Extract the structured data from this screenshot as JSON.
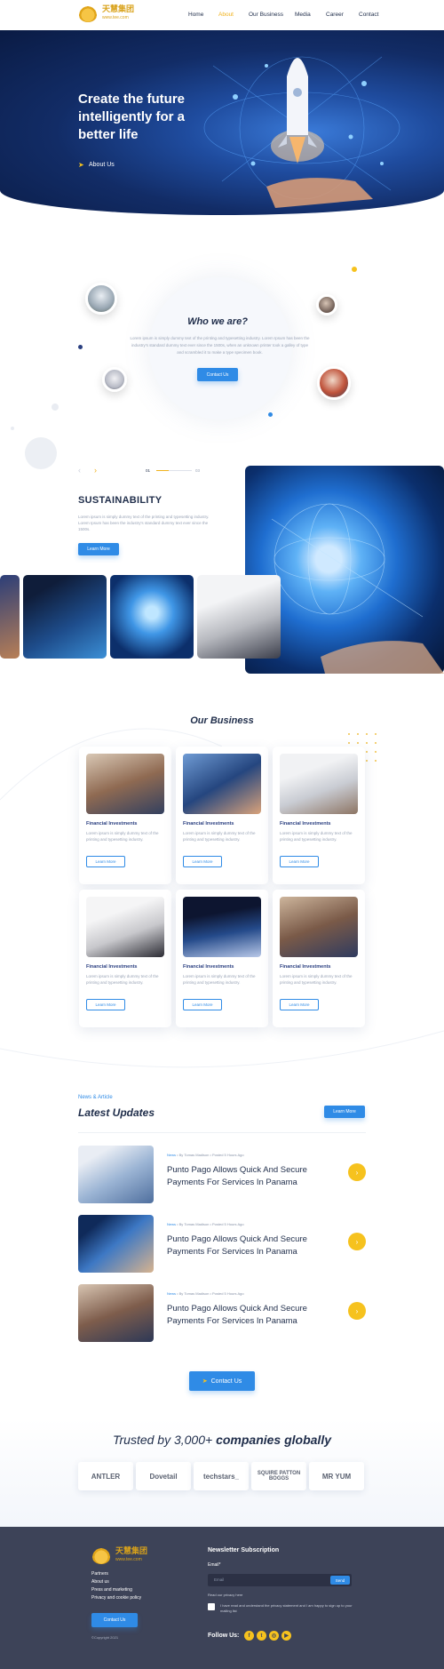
{
  "brand": {
    "name_cn": "天慧集团",
    "url": "www.tee.com"
  },
  "nav": {
    "items": [
      "Home",
      "About",
      "Our Business",
      "Media",
      "Career",
      "Contact"
    ],
    "active": "About"
  },
  "hero": {
    "title": "Create the future intelligently for a better life",
    "cta": "About Us"
  },
  "who": {
    "title": "Who we are?",
    "text": "Lorem ipsum is simply dummy text of the printing and typesetting industry. Lorem Ipsum has been the industry's standard dummy text ever since the 1500s, when an unknown printer took a galley of type and scrambled it to make a type specimen book.",
    "cta": "Contact Us"
  },
  "sustainability": {
    "slide_current": "01",
    "slide_total": "03",
    "title": "SUSTAINABILITY",
    "text": "Lorem ipsum is simply dummy text of the printing and typesetting industry. Lorem Ipsum has been the industry's standard dummy text ever since the 1500s.",
    "cta": "Learn More"
  },
  "business": {
    "title": "Our Business",
    "cards": [
      {
        "title": "Financial Investments",
        "desc": "Lorem ipsum is simply dummy text of the printing and typesetting industry.",
        "cta": "Learn More"
      },
      {
        "title": "Financial Investments",
        "desc": "Lorem ipsum is simply dummy text of the printing and typesetting industry.",
        "cta": "Learn More"
      },
      {
        "title": "Financial Investments",
        "desc": "Lorem ipsum is simply dummy text of the printing and typesetting industry.",
        "cta": "Learn More"
      },
      {
        "title": "Financial Investments",
        "desc": "Lorem ipsum is simply dummy text of the printing and typesetting industry.",
        "cta": "Learn More"
      },
      {
        "title": "Financial Investments",
        "desc": "Lorem ipsum is simply dummy text of the printing and typesetting industry.",
        "cta": "Learn More"
      },
      {
        "title": "Financial Investments",
        "desc": "Lorem ipsum is simply dummy text of the printing and typesetting industry.",
        "cta": "Learn More"
      }
    ]
  },
  "news": {
    "kicker": "News & Article",
    "title": "Latest Updates",
    "cta": "Learn More",
    "items": [
      {
        "tag": "News",
        "author": "By Tomas Madison",
        "time": "Posted 5 Hours Ago",
        "headline": "Punto Pago Allows Quick And Secure Payments For Services In Panama"
      },
      {
        "tag": "News",
        "author": "By Tomas Madison",
        "time": "Posted 5 Hours Ago",
        "headline": "Punto Pago Allows Quick And Secure Payments For Services In Panama"
      },
      {
        "tag": "News",
        "author": "By Tomas Madison",
        "time": "Posted 5 Hours Ago",
        "headline": "Punto Pago Allows Quick And Secure Payments For Services In Panama"
      }
    ],
    "contact_cta": "Contact Us"
  },
  "trusted": {
    "lead": "Trusted by 3,000+",
    "emph": "companies globally",
    "logos": [
      "ANTLER",
      "Dovetail",
      "techstars_",
      "SQUIRE PATTON BOGGS",
      "MR YUM"
    ]
  },
  "footer": {
    "links": [
      "Partners",
      "About us",
      "Press and marketing",
      "Privacy and cookie policy"
    ],
    "cta": "Contact Us",
    "copyright": "©Copyright 2021",
    "newsletter_title": "Newsletter Subscription",
    "email_label": "Email*",
    "email_placeholder": "Email",
    "send": "Send",
    "privacy_link": "Read our privacy here",
    "consent": "I have read and understand the privacy statement and I am happy to sign up to your mailing list",
    "follow": "Follow Us:",
    "social_icons": [
      "facebook-icon",
      "twitter-icon",
      "instagram-icon",
      "youtube-icon"
    ]
  },
  "colors": {
    "accent": "#2f8be6",
    "gold": "#f0b21c",
    "navy": "#1f2d4a",
    "footer": "#3d4358"
  }
}
